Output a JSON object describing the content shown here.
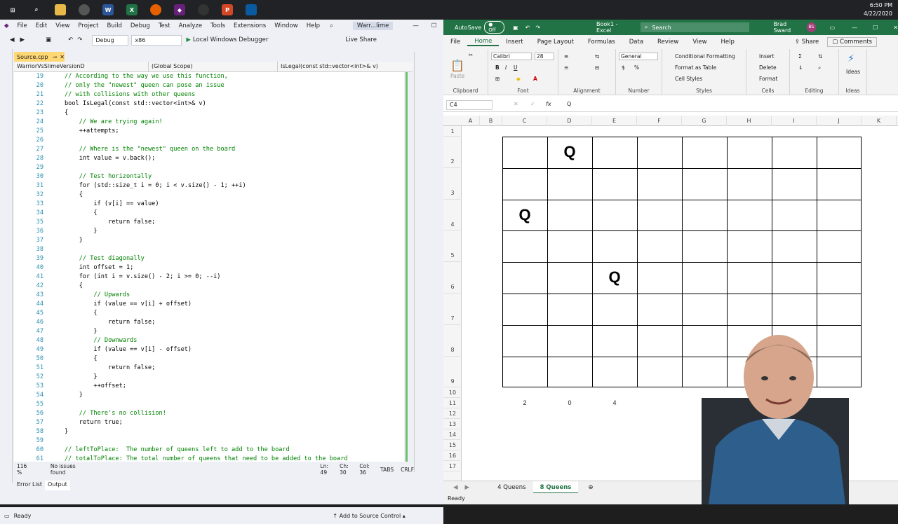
{
  "taskbar": {
    "time": "6:50 PM",
    "date": "4/22/2020"
  },
  "vs": {
    "menu": [
      "File",
      "Edit",
      "View",
      "Project",
      "Build",
      "Debug",
      "Test",
      "Analyze",
      "Tools",
      "Extensions",
      "Window",
      "Help"
    ],
    "solution_name": "Warr...lime",
    "live_share": "Live Share",
    "config": "Debug",
    "platform": "x86",
    "debugger": "Local Windows Debugger",
    "doc_tab": "Source.cpp",
    "nav": {
      "project": "WarriorVsSlimeVersionD",
      "scope": "(Global Scope)",
      "function": "IsLegal(const std::vector<int>& v)"
    },
    "code": [
      {
        "n": "19",
        "t": "// According to the way we use this function,"
      },
      {
        "n": "20",
        "t": "// only the \"newest\" queen can pose an issue"
      },
      {
        "n": "21",
        "t": "// with collisions with other queens"
      },
      {
        "n": "22",
        "t": "bool IsLegal(const std::vector<int>& v)"
      },
      {
        "n": "23",
        "t": "{"
      },
      {
        "n": "24",
        "t": "    // We are trying again!"
      },
      {
        "n": "25",
        "t": "    ++attempts;"
      },
      {
        "n": "26",
        "t": ""
      },
      {
        "n": "27",
        "t": "    // Where is the \"newest\" queen on the board"
      },
      {
        "n": "28",
        "t": "    int value = v.back();"
      },
      {
        "n": "29",
        "t": ""
      },
      {
        "n": "30",
        "t": "    // Test horizontally"
      },
      {
        "n": "31",
        "t": "    for (std::size_t i = 0; i < v.size() - 1; ++i)"
      },
      {
        "n": "32",
        "t": "    {"
      },
      {
        "n": "33",
        "t": "        if (v[i] == value)"
      },
      {
        "n": "34",
        "t": "        {"
      },
      {
        "n": "35",
        "t": "            return false;"
      },
      {
        "n": "36",
        "t": "        }"
      },
      {
        "n": "37",
        "t": "    }"
      },
      {
        "n": "38",
        "t": ""
      },
      {
        "n": "39",
        "t": "    // Test diagonally"
      },
      {
        "n": "40",
        "t": "    int offset = 1;"
      },
      {
        "n": "41",
        "t": "    for (int i = v.size() - 2; i >= 0; --i)"
      },
      {
        "n": "42",
        "t": "    {"
      },
      {
        "n": "43",
        "t": "        // Upwards"
      },
      {
        "n": "44",
        "t": "        if (value == v[i] + offset)"
      },
      {
        "n": "45",
        "t": "        {"
      },
      {
        "n": "46",
        "t": "            return false;"
      },
      {
        "n": "47",
        "t": "        }"
      },
      {
        "n": "48",
        "t": "        // Downwards"
      },
      {
        "n": "49",
        "t": "        if (value == v[i] - offset)"
      },
      {
        "n": "50",
        "t": "        {"
      },
      {
        "n": "51",
        "t": "            return false;"
      },
      {
        "n": "52",
        "t": "        }"
      },
      {
        "n": "53",
        "t": "        ++offset;"
      },
      {
        "n": "54",
        "t": "    }"
      },
      {
        "n": "55",
        "t": ""
      },
      {
        "n": "56",
        "t": "    // There's no collision!"
      },
      {
        "n": "57",
        "t": "    return true;"
      },
      {
        "n": "58",
        "t": "}"
      },
      {
        "n": "59",
        "t": ""
      },
      {
        "n": "60",
        "t": "// leftToPlace:  The number of queens left to add to the board"
      },
      {
        "n": "61",
        "t": "// totalToPlace: The total number of queens that need to be added to the board"
      }
    ],
    "zoom": "116 %",
    "issues": "No issues found",
    "cursor": {
      "ln": "Ln: 49",
      "ch": "Ch: 30",
      "col": "Col: 36",
      "tabs": "TABS",
      "eol": "CRLF"
    },
    "bottom_tabs": [
      "Error List",
      "Output"
    ],
    "status": "Ready",
    "source_control": "Add to Source Control"
  },
  "excel": {
    "autosave": "AutoSave",
    "autosave_state": "Off",
    "title": "Book1 - Excel",
    "search": "Search",
    "user": "Brad Sward",
    "user_initials": "BS",
    "tabs": [
      "File",
      "Home",
      "Insert",
      "Page Layout",
      "Formulas",
      "Data",
      "Review",
      "View",
      "Help"
    ],
    "share": "Share",
    "comments": "Comments",
    "ribbon": {
      "paste": "Paste",
      "clipboard": "Clipboard",
      "font_name": "Calibri",
      "font_size": "28",
      "font": "Font",
      "alignment": "Alignment",
      "number_format": "General",
      "number": "Number",
      "conditional": "Conditional Formatting",
      "format_table": "Format as Table",
      "cell_styles": "Cell Styles",
      "styles": "Styles",
      "insert": "Insert",
      "delete": "Delete",
      "format": "Format",
      "cells": "Cells",
      "editing": "Editing",
      "ideas": "Ideas"
    },
    "name_box": "C4",
    "formula": "Q",
    "columns": [
      "A",
      "B",
      "C",
      "D",
      "E",
      "F",
      "G",
      "H",
      "I",
      "J",
      "K"
    ],
    "rows": [
      "1",
      "2",
      "3",
      "4",
      "5",
      "6",
      "7",
      "8",
      "9",
      "10",
      "11",
      "12",
      "13",
      "14",
      "15",
      "16",
      "17"
    ],
    "queen_label": "Q",
    "queens": [
      {
        "col": "D",
        "row": "2"
      },
      {
        "col": "C",
        "row": "4"
      },
      {
        "col": "E",
        "row": "6"
      }
    ],
    "row11": [
      "2",
      "0",
      "4"
    ],
    "sheets": [
      "4 Queens",
      "8 Queens"
    ],
    "active_sheet": "8 Queens",
    "status": "Ready"
  }
}
